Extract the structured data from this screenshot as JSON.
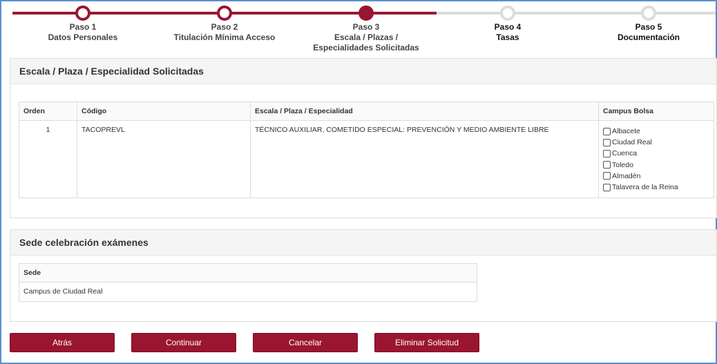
{
  "stepper": {
    "steps": [
      {
        "title": "Paso 1",
        "name": "Datos Personales",
        "state": "done"
      },
      {
        "title": "Paso 2",
        "name": "Titulación Mínima Acceso",
        "state": "done"
      },
      {
        "title": "Paso 3",
        "name": "Escala / Plazas / Especialidades Solicitadas",
        "state": "current"
      },
      {
        "title": "Paso 4",
        "name": "Tasas",
        "state": "pending"
      },
      {
        "title": "Paso 5",
        "name": "Documentación",
        "state": "pending"
      }
    ]
  },
  "solicitadas": {
    "title": "Escala / Plaza / Especialidad Solicitadas",
    "headers": {
      "orden": "Orden",
      "codigo": "Código",
      "escala": "Escala / Plaza / Especialidad",
      "campus": "Campus Bolsa"
    },
    "row": {
      "orden": "1",
      "codigo": "TACOPREVL",
      "escala": "TÉCNICO AUXILIAR, COMETIDO ESPECIAL: PREVENCIÓN Y MEDIO AMBIENTE LIBRE",
      "campus": [
        "Albacete",
        "Ciudad Real",
        "Cuenca",
        "Toledo",
        "Almadén",
        "Talavera de la Reina"
      ]
    }
  },
  "sede": {
    "title": "Sede celebración exámenes",
    "header": "Sede",
    "value": "Campus de Ciudad Real"
  },
  "buttons": {
    "atras": "Atrás",
    "continuar": "Continuar",
    "cancelar": "Cancelar",
    "eliminar": "Eliminar Solicitud"
  },
  "colors": {
    "accent": "#9a1530",
    "inactive": "#dcdcdc",
    "frame": "#5b8fd0"
  }
}
